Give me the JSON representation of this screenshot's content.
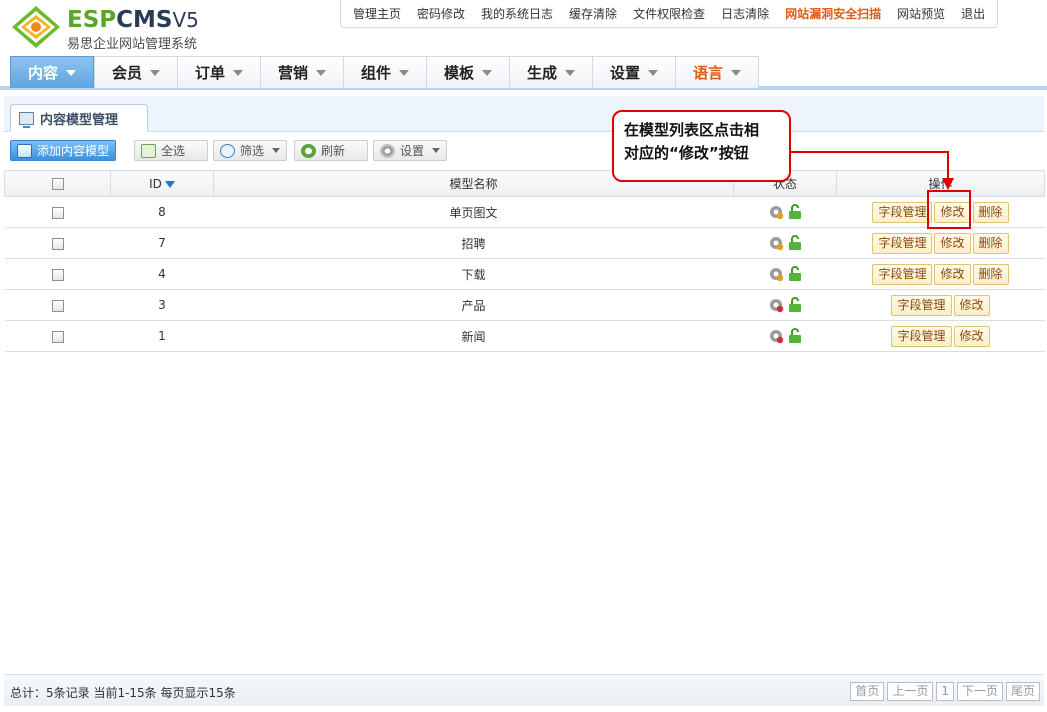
{
  "logo": {
    "brand_esp": "ESP",
    "brand_cms": "CMS",
    "brand_ver": "V5",
    "subtitle": "易思企业网站管理系统"
  },
  "topnav": [
    {
      "label": "管理主页",
      "name": "topnav-home"
    },
    {
      "label": "密码修改",
      "name": "topnav-password"
    },
    {
      "label": "我的系统日志",
      "name": "topnav-mylog"
    },
    {
      "label": "缓存清除",
      "name": "topnav-cache"
    },
    {
      "label": "文件权限检查",
      "name": "topnav-permission"
    },
    {
      "label": "日志清除",
      "name": "topnav-clear-log"
    },
    {
      "label": "网站漏洞安全扫描",
      "name": "topnav-security-scan",
      "warn": true
    },
    {
      "label": "网站预览",
      "name": "topnav-preview"
    },
    {
      "label": "退出",
      "name": "topnav-logout"
    }
  ],
  "mainnav": [
    {
      "label": "内容",
      "name": "nav-content",
      "active": true
    },
    {
      "label": "会员",
      "name": "nav-member"
    },
    {
      "label": "订单",
      "name": "nav-order"
    },
    {
      "label": "营销",
      "name": "nav-marketing"
    },
    {
      "label": "组件",
      "name": "nav-components"
    },
    {
      "label": "模板",
      "name": "nav-templates"
    },
    {
      "label": "生成",
      "name": "nav-generate"
    },
    {
      "label": "设置",
      "name": "nav-settings"
    },
    {
      "label": "语言",
      "name": "nav-language",
      "lang": true
    }
  ],
  "pane_tab": "内容模型管理",
  "toolbar": {
    "add": "添加内容模型",
    "select_all": "全选",
    "filter": "筛选",
    "refresh": "刷新",
    "settings": "设置"
  },
  "table": {
    "headers": {
      "id": "ID",
      "name": "模型名称",
      "status": "状态",
      "actions": "操作"
    },
    "rows": [
      {
        "id": "8",
        "name": "单页图文",
        "deletable": true
      },
      {
        "id": "7",
        "name": "招聘",
        "deletable": true
      },
      {
        "id": "4",
        "name": "下载",
        "deletable": true
      },
      {
        "id": "3",
        "name": "产品",
        "deletable": false
      },
      {
        "id": "1",
        "name": "新闻",
        "deletable": false
      }
    ],
    "action_labels": {
      "fields": "字段管理",
      "edit": "修改",
      "delete": "删除"
    }
  },
  "footer": {
    "summary": "总计：5条记录 当前1-15条 每页显示15条",
    "pager": {
      "first": "首页",
      "prev": "上一页",
      "page": "1",
      "next": "下一页",
      "last": "尾页"
    }
  },
  "annotation": {
    "line1": "在模型列表区点击相",
    "line2": "对应的“修改”按钮"
  },
  "colors": {
    "accent": "#3c90da",
    "warn": "#e05b17",
    "callout": "#e00000"
  }
}
